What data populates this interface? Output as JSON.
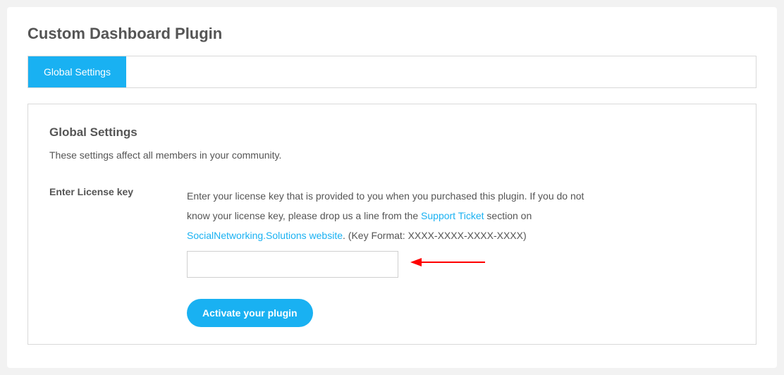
{
  "page": {
    "title": "Custom Dashboard Plugin"
  },
  "tabs": [
    {
      "label": "Global Settings"
    }
  ],
  "section": {
    "title": "Global Settings",
    "description": "These settings affect all members in your community."
  },
  "form": {
    "license": {
      "label": "Enter License key",
      "hint_prefix": "Enter your license key that is provided to you when you purchased this plugin. If you do not know your license key, please drop us a line from the ",
      "support_link_text": "Support Ticket",
      "hint_mid": " section on ",
      "website_link_text": "SocialNetworking.Solutions website",
      "hint_suffix": ". (Key Format: XXXX-XXXX-XXXX-XXXX)",
      "value": ""
    },
    "submit_label": "Activate your plugin"
  },
  "colors": {
    "primary": "#19b1f2",
    "text": "#555555",
    "border": "#d9d9d9",
    "annotation": "#ff0000"
  }
}
